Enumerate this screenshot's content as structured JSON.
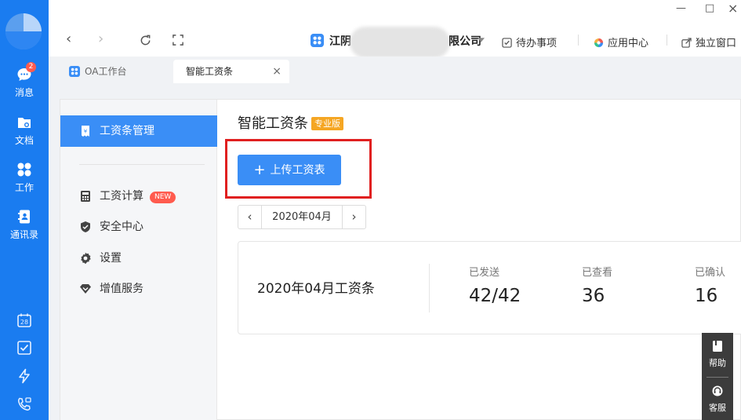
{
  "window": {
    "minimize": "—",
    "maximize": "□",
    "close": "×"
  },
  "rail": {
    "items": [
      {
        "label": "消息",
        "badge": "2"
      },
      {
        "label": "文档"
      },
      {
        "label": "工作"
      },
      {
        "label": "通讯录"
      }
    ],
    "bottom_icons": [
      "calendar-icon",
      "check-icon",
      "lightning-icon",
      "phone-icon"
    ],
    "calendar_day": "28"
  },
  "toolbar": {
    "company_name": "江阴",
    "company_suffix": "限公司",
    "links": [
      "待办事项",
      "应用中心",
      "独立窗口"
    ]
  },
  "tabs": [
    {
      "label": "OA工作台",
      "active": false
    },
    {
      "label": "智能工资条",
      "active": true
    }
  ],
  "sidebar": {
    "active": {
      "label": "工资条管理"
    },
    "items": [
      {
        "label": "工资计算",
        "tag": "NEW"
      },
      {
        "label": "安全中心"
      },
      {
        "label": "设置"
      },
      {
        "label": "增值服务"
      }
    ]
  },
  "page": {
    "title": "智能工资条",
    "edition": "专业版",
    "upload_label": "上传工资表",
    "month": "2020年04月",
    "card": {
      "title": "2020年04月工资条",
      "stats": [
        {
          "label": "已发送",
          "value": "42/42"
        },
        {
          "label": "已查看",
          "value": "36"
        },
        {
          "label": "已确认",
          "value": "16"
        }
      ]
    }
  },
  "float": {
    "help": "帮助",
    "service": "客服"
  },
  "colors": {
    "rail": "#1a7cf0",
    "primary": "#3a8ef6",
    "badge": "#ff5b4e",
    "highlight": "#e02020",
    "pro": "#f5a623"
  }
}
